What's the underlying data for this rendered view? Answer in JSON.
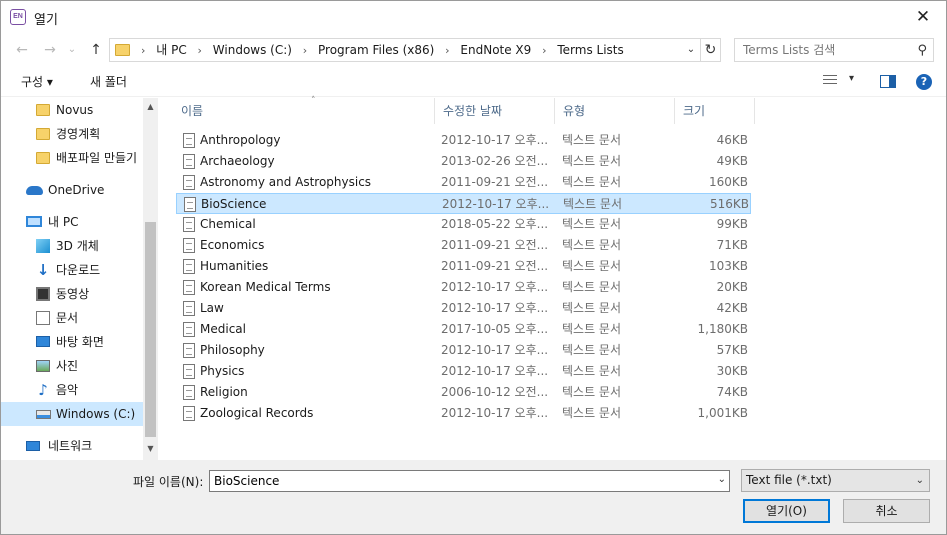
{
  "window": {
    "app_icon_text": "EN",
    "title": "열기"
  },
  "address": {
    "crumbs": [
      "내 PC",
      "Windows  (C:)",
      "Program Files (x86)",
      "EndNote X9",
      "Terms Lists"
    ],
    "search_placeholder": "Terms Lists 검색"
  },
  "toolbar": {
    "organize": "구성 ▾",
    "new_folder": "새 폴더",
    "help": "?"
  },
  "nav": {
    "items": [
      {
        "label": "Novus",
        "icon": "folder-icon"
      },
      {
        "label": "경영계획",
        "icon": "folder-icon"
      },
      {
        "label": "배포파일 만들기",
        "icon": "folder-icon"
      },
      {
        "label": "OneDrive",
        "icon": "onedrive-icon"
      },
      {
        "label": "내 PC",
        "icon": "pc-icon"
      },
      {
        "label": "3D 개체",
        "icon": "3d-objects-icon"
      },
      {
        "label": "다운로드",
        "icon": "download-icon"
      },
      {
        "label": "동영상",
        "icon": "video-icon"
      },
      {
        "label": "문서",
        "icon": "document-icon"
      },
      {
        "label": "바탕 화면",
        "icon": "desktop-icon"
      },
      {
        "label": "사진",
        "icon": "pictures-icon"
      },
      {
        "label": "음악",
        "icon": "music-icon"
      },
      {
        "label": "Windows  (C:)",
        "icon": "drive-icon"
      },
      {
        "label": "네트워크",
        "icon": "network-icon"
      }
    ]
  },
  "columns": {
    "name": "이름",
    "date": "수정한 날짜",
    "type": "유형",
    "size": "크기"
  },
  "files": [
    {
      "name": "Anthropology",
      "date": "2012-10-17 오후...",
      "type": "텍스트 문서",
      "size": "46KB"
    },
    {
      "name": "Archaeology",
      "date": "2013-02-26 오전...",
      "type": "텍스트 문서",
      "size": "49KB"
    },
    {
      "name": "Astronomy and Astrophysics",
      "date": "2011-09-21 오전...",
      "type": "텍스트 문서",
      "size": "160KB"
    },
    {
      "name": "BioScience",
      "date": "2012-10-17 오후...",
      "type": "텍스트 문서",
      "size": "516KB"
    },
    {
      "name": "Chemical",
      "date": "2018-05-22 오후...",
      "type": "텍스트 문서",
      "size": "99KB"
    },
    {
      "name": "Economics",
      "date": "2011-09-21 오전...",
      "type": "텍스트 문서",
      "size": "71KB"
    },
    {
      "name": "Humanities",
      "date": "2011-09-21 오전...",
      "type": "텍스트 문서",
      "size": "103KB"
    },
    {
      "name": "Korean Medical Terms",
      "date": "2012-10-17 오후...",
      "type": "텍스트 문서",
      "size": "20KB"
    },
    {
      "name": "Law",
      "date": "2012-10-17 오후...",
      "type": "텍스트 문서",
      "size": "42KB"
    },
    {
      "name": "Medical",
      "date": "2017-10-05 오후...",
      "type": "텍스트 문서",
      "size": "1,180KB"
    },
    {
      "name": "Philosophy",
      "date": "2012-10-17 오후...",
      "type": "텍스트 문서",
      "size": "57KB"
    },
    {
      "name": "Physics",
      "date": "2012-10-17 오후...",
      "type": "텍스트 문서",
      "size": "30KB"
    },
    {
      "name": "Religion",
      "date": "2006-10-12 오전...",
      "type": "텍스트 문서",
      "size": "74KB"
    },
    {
      "name": "Zoological Records",
      "date": "2012-10-17 오후...",
      "type": "텍스트 문서",
      "size": "1,001KB"
    }
  ],
  "footer": {
    "filename_label": "파일 이름(N):",
    "filename_value": "BioScience",
    "filetype": "Text file  (*.txt)",
    "open_label": "열기(O)",
    "cancel_label": "취소"
  },
  "colors": {
    "selection": "#cce8ff",
    "accent": "#0078d7"
  }
}
